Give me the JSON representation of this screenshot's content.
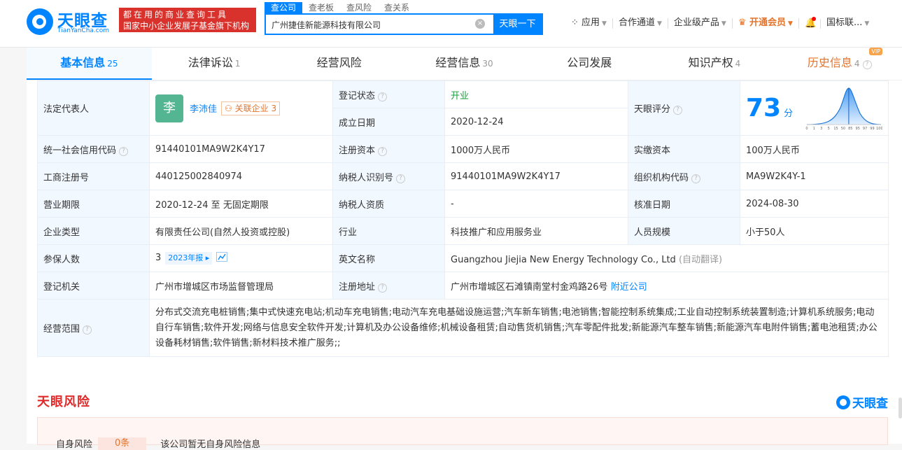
{
  "brand": {
    "name": "天眼查",
    "domain": "TianYanCha.com"
  },
  "slogan": {
    "line1": "都在用的商业查询工具",
    "line2": "国家中小企业发展子基金旗下机构"
  },
  "search": {
    "tabs": [
      "查公司",
      "查老板",
      "查风险",
      "查关系"
    ],
    "value": "广州捷佳新能源科技有限公司",
    "button": "天眼一下"
  },
  "topnav": [
    "应用",
    "合作通道",
    "企业级产品",
    "开通会员",
    "国标联..."
  ],
  "tabs": [
    {
      "label": "基本信息",
      "count": "25"
    },
    {
      "label": "法律诉讼",
      "count": "1"
    },
    {
      "label": "经营风险",
      "count": ""
    },
    {
      "label": "经营信息",
      "count": "30"
    },
    {
      "label": "公司发展",
      "count": ""
    },
    {
      "label": "知识产权",
      "count": "4"
    },
    {
      "label": "历史信息",
      "count": "4",
      "badge": "VIP"
    }
  ],
  "info": {
    "legal_rep_label": "法定代表人",
    "legal_rep_avatar": "李",
    "legal_rep_name": "李沛佳",
    "related_label": "关联企业",
    "related_count": "3",
    "reg_status_label": "登记状态",
    "reg_status": "开业",
    "found_date_label": "成立日期",
    "found_date": "2020-12-24",
    "score_label": "天眼评分",
    "score": "73",
    "score_unit": "分",
    "score_ticks": [
      "0",
      "1",
      "3",
      "5",
      "15",
      "50",
      "85",
      "95",
      "97",
      "99",
      "100"
    ],
    "credit_code_label": "统一社会信用代码",
    "credit_code": "91440101MA9W2K4Y17",
    "reg_capital_label": "注册资本",
    "reg_capital": "1000万人民币",
    "paid_capital_label": "实缴资本",
    "paid_capital": "100万人民币",
    "biz_reg_no_label": "工商注册号",
    "biz_reg_no": "440125002840974",
    "taxpayer_id_label": "纳税人识别号",
    "taxpayer_id": "91440101MA9W2K4Y17",
    "org_code_label": "组织机构代码",
    "org_code": "MA9W2K4Y-1",
    "term_label": "营业期限",
    "term": "2020-12-24 至 无固定期限",
    "tax_qual_label": "纳税人资质",
    "tax_qual": "-",
    "approve_date_label": "核准日期",
    "approve_date": "2024-08-30",
    "type_label": "企业类型",
    "type": "有限责任公司(自然人投资或控股)",
    "industry_label": "行业",
    "industry": "科技推广和应用服务业",
    "staff_size_label": "人员规模",
    "staff_size": "小于50人",
    "insured_label": "参保人数",
    "insured": "3",
    "insured_year": "2023年报",
    "en_name_label": "英文名称",
    "en_name": "Guangzhou Jiejia New Energy Technology Co., Ltd",
    "auto_translate": "(自动翻译)",
    "authority_label": "登记机关",
    "authority": "广州市增城区市场监督管理局",
    "address_label": "注册地址",
    "address": "广州市增城区石滩镇南堂村金鸡路26号",
    "nearby": "附近公司",
    "scope_label": "经营范围",
    "scope": "分布式交流充电桩销售;集中式快速充电站;机动车充电销售;电动汽车充电基础设施运营;汽车新车销售;电池销售;智能控制系统集成;工业自动控制系统装置制造;计算机系统服务;电动自行车销售;软件开发;网络与信息安全软件开发;计算机及办公设备维修;机械设备租赁;自动售货机销售;汽车零配件批发;新能源汽车整车销售;新能源汽车电附件销售;蓄电池租赁;办公设备耗材销售;软件销售;新材料技术推广服务;;"
  },
  "risk": {
    "section_title": "天眼风险",
    "brand": "天眼查",
    "label": "自身风险",
    "count": "0条",
    "message": "该公司暂无自身风险信息"
  },
  "colors": {
    "primary": "#0084ff",
    "vip": "#e4742c",
    "risk": "#e02a2a",
    "status_ok": "#18a03c"
  }
}
